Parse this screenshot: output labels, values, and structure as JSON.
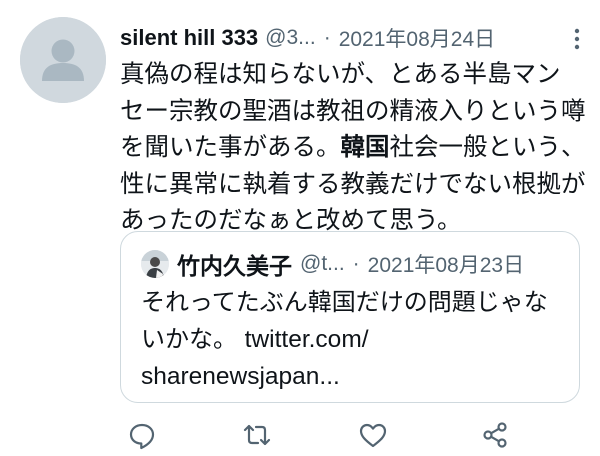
{
  "tweet": {
    "display_name": "silent hill 333",
    "handle": "@3...",
    "separator": "·",
    "date": "2021年08月24日",
    "text_lines": {
      "line1": "真偽の程は知らないが、とある半島マン",
      "line2": "セー宗教の聖酒は教祖の精液入りという噂",
      "line3": "を聞いた事がある。",
      "line3_bold": "韓国",
      "line3_rest": "社会一般という、",
      "line4": "性に異常に執着する教義だけでない根拠が",
      "line5": "あったのだなぁと改めて思う。"
    }
  },
  "quote": {
    "display_name": "竹内久美子",
    "handle": "@t...",
    "separator": "·",
    "date": "2021年08月23日",
    "text_lines": {
      "line1": "それってたぶん韓国だけの問題じゃな",
      "line2_text": "いかな。",
      "line2_link": "twitter.com/",
      "line3_link": "sharenewsjapan..."
    }
  },
  "icons": {
    "more": "more-dots-icon",
    "reply": "reply-icon",
    "retweet": "retweet-icon",
    "like": "heart-icon",
    "share": "share-icon"
  },
  "colors": {
    "text": "#0f1419",
    "secondary": "#536471",
    "border": "#cfd9de",
    "avatar_bg": "#d0d8de"
  }
}
